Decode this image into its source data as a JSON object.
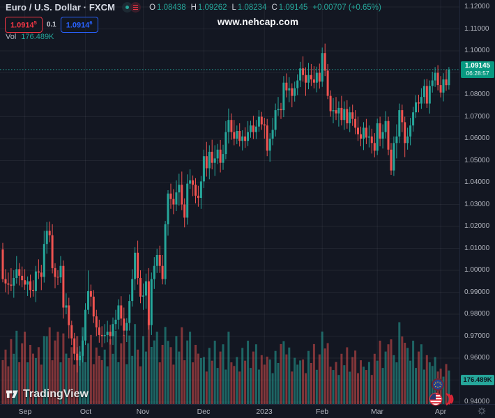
{
  "header": {
    "symbol_title": "Euro / U.S. Dollar · FXCM",
    "ohlc": {
      "o_label": "O",
      "o": "1.08438",
      "h_label": "H",
      "h": "1.09262",
      "l_label": "L",
      "l": "1.08234",
      "c_label": "C",
      "c": "1.09145",
      "change": "+0.00707 (+0.65%)"
    },
    "bid": {
      "base": "1.0914",
      "sup": "5"
    },
    "spread": "0.1",
    "ask": {
      "base": "1.0914",
      "sup": "6"
    },
    "vol_label": "Vol",
    "vol_value": "176.489K"
  },
  "watermark": "www.nehcap.com",
  "logo_text": "TradingView",
  "price_axis": {
    "labels": [
      {
        "text": "1.12000",
        "p": 1.12
      },
      {
        "text": "1.11000",
        "p": 1.11
      },
      {
        "text": "1.10000",
        "p": 1.1
      },
      {
        "text": "1.08000",
        "p": 1.08
      },
      {
        "text": "1.07000",
        "p": 1.07
      },
      {
        "text": "1.06000",
        "p": 1.06
      },
      {
        "text": "1.05000",
        "p": 1.05
      },
      {
        "text": "1.04000",
        "p": 1.04
      },
      {
        "text": "1.03000",
        "p": 1.03
      },
      {
        "text": "1.02000",
        "p": 1.02
      },
      {
        "text": "1.01000",
        "p": 1.01
      },
      {
        "text": "1.00000",
        "p": 1.0
      },
      {
        "text": "0.99000",
        "p": 0.99
      },
      {
        "text": "0.98000",
        "p": 0.98
      },
      {
        "text": "0.97000",
        "p": 0.97
      },
      {
        "text": "0.96000",
        "p": 0.96
      },
      {
        "text": "0.94000",
        "p": 0.94
      }
    ],
    "price_badge": {
      "price": "1.09145",
      "countdown": "06:28:57"
    },
    "volume_badge": "176.489K"
  },
  "colors": {
    "background": "#131722",
    "up": "#26a69a",
    "down": "#ef5350",
    "up_volume": "rgba(38,166,154,0.55)",
    "down_volume": "rgba(239,83,80,0.50)",
    "grid": "rgba(255,255,255,0.06)",
    "badge_green": "#089981",
    "bid_red": "#f23645",
    "ask_blue": "#2962ff",
    "axis_text": "#b2b5be"
  },
  "chart_data": {
    "type": "candlestick",
    "title": "Euro / U.S. Dollar · FXCM",
    "last_price": 1.09145,
    "last_price_label": "1.09145",
    "countdown": "06:28:57",
    "current_volume_label": "176.489K",
    "y_axis": {
      "min": 0.94,
      "max": 1.12,
      "tick": 0.01
    },
    "x_axis": {
      "ticks": [
        {
          "label": "Sep",
          "index": 8
        },
        {
          "label": "Oct",
          "index": 30
        },
        {
          "label": "Nov",
          "index": 51
        },
        {
          "label": "Dec",
          "index": 73
        },
        {
          "label": "2023",
          "index": 95
        },
        {
          "label": "Feb",
          "index": 116
        },
        {
          "label": "Mar",
          "index": 136
        },
        {
          "label": "Apr",
          "index": 159
        }
      ]
    },
    "volume_scale_max": 450,
    "candles": [
      [
        1.0095,
        1.0125,
        0.9945,
        0.996,
        231
      ],
      [
        0.996,
        1.0005,
        0.99,
        0.994,
        286
      ],
      [
        0.994,
        0.999,
        0.989,
        0.9935,
        198
      ],
      [
        0.9935,
        1.001,
        0.9905,
        0.993,
        341
      ],
      [
        0.993,
        1.0,
        0.9875,
        0.9965,
        264
      ],
      [
        0.9965,
        1.0065,
        0.9939,
        1.0005,
        385
      ],
      [
        1.0005,
        1.0033,
        0.9931,
        0.9975,
        220
      ],
      [
        0.9975,
        1.0017,
        0.9923,
        0.9955,
        319
      ],
      [
        0.9955,
        1.0005,
        0.9911,
        0.9935,
        380
      ],
      [
        0.9935,
        0.9972,
        0.9883,
        0.995,
        219
      ],
      [
        0.995,
        0.998,
        0.9875,
        0.991,
        311
      ],
      [
        0.991,
        0.9955,
        0.988,
        0.9905,
        265
      ],
      [
        0.9905,
        1.002,
        0.9855,
        0.9995,
        242
      ],
      [
        0.9995,
        1.005,
        0.996,
        0.999,
        299
      ],
      [
        0.999,
        1.0025,
        0.991,
        0.997,
        207
      ],
      [
        0.997,
        1.018,
        0.9944,
        1.012,
        357
      ],
      [
        1.012,
        1.022,
        1.0076,
        1.018,
        356
      ],
      [
        1.018,
        1.0222,
        1.0128,
        1.016,
        403
      ],
      [
        1.016,
        1.021,
        0.9986,
        1.001,
        230
      ],
      [
        1.001,
        1.0032,
        0.9918,
        0.997,
        334
      ],
      [
        0.997,
        1.0,
        0.9933,
        0.9968,
        380
      ],
      [
        0.9968,
        1.0065,
        0.9943,
        1.002,
        219
      ],
      [
        1.002,
        1.0045,
        0.978,
        0.983,
        371
      ],
      [
        0.983,
        0.9895,
        0.98,
        0.984,
        265
      ],
      [
        0.984,
        0.9875,
        0.969,
        0.975,
        242
      ],
      [
        0.975,
        0.977,
        0.966,
        0.969,
        299
      ],
      [
        0.969,
        0.9715,
        0.959,
        0.962,
        207
      ],
      [
        0.962,
        0.965,
        0.9535,
        0.959,
        357
      ],
      [
        0.959,
        0.9655,
        0.9565,
        0.961,
        276
      ],
      [
        0.961,
        0.97,
        0.958,
        0.968,
        403
      ],
      [
        0.968,
        0.985,
        0.966,
        0.982,
        220
      ],
      [
        0.982,
        0.9999,
        0.98,
        0.9905,
        319
      ],
      [
        0.9905,
        0.9935,
        0.9835,
        0.988,
        363
      ],
      [
        0.988,
        0.991,
        0.976,
        0.979,
        209
      ],
      [
        0.979,
        0.982,
        0.97,
        0.974,
        297
      ],
      [
        0.974,
        0.9775,
        0.967,
        0.9705,
        253
      ],
      [
        0.9705,
        0.9745,
        0.965,
        0.97,
        231
      ],
      [
        0.97,
        0.9755,
        0.9668,
        0.9705,
        286
      ],
      [
        0.9705,
        0.977,
        0.9672,
        0.972,
        198
      ],
      [
        0.972,
        0.9752,
        0.9662,
        0.97,
        341
      ],
      [
        0.97,
        0.9785,
        0.966,
        0.9755,
        264
      ],
      [
        0.9755,
        0.982,
        0.9729,
        0.9775,
        385
      ],
      [
        0.9775,
        0.9868,
        0.9731,
        0.984,
        220
      ],
      [
        0.984,
        0.9882,
        0.9748,
        0.978,
        319
      ],
      [
        0.978,
        0.983,
        0.9701,
        0.9725,
        363
      ],
      [
        0.9725,
        0.9782,
        0.9673,
        0.976,
        209
      ],
      [
        0.976,
        0.989,
        0.9725,
        0.986,
        360
      ],
      [
        0.986,
        1.0005,
        0.9835,
        0.996,
        253
      ],
      [
        0.996,
        1.0105,
        0.991,
        1.008,
        420
      ],
      [
        1.008,
        1.0135,
        0.9935,
        0.9965,
        286
      ],
      [
        0.9965,
        1.0,
        0.985,
        0.988,
        198
      ],
      [
        0.988,
        0.994,
        0.982,
        0.9885,
        357
      ],
      [
        0.9885,
        0.9985,
        0.9825,
        0.995,
        276
      ],
      [
        0.995,
        1.001,
        0.973,
        0.975,
        445
      ],
      [
        0.975,
        0.999,
        0.9705,
        0.996,
        300
      ],
      [
        0.996,
        1.006,
        0.9915,
        1.002,
        334
      ],
      [
        1.002,
        1.0098,
        0.9988,
        1.007,
        380
      ],
      [
        1.007,
        1.0112,
        0.9988,
        1.002,
        219
      ],
      [
        1.002,
        1.007,
        0.9936,
        0.996,
        311
      ],
      [
        0.996,
        1.0225,
        0.9935,
        1.021,
        405
      ],
      [
        1.021,
        1.0365,
        1.0158,
        1.035,
        332
      ],
      [
        1.035,
        1.0395,
        1.028,
        1.0325,
        299
      ],
      [
        1.0325,
        1.037,
        1.0256,
        1.03,
        207
      ],
      [
        1.03,
        1.041,
        1.027,
        1.0355,
        357
      ],
      [
        1.0355,
        1.044,
        1.0295,
        1.039,
        276
      ],
      [
        1.039,
        1.045,
        1.0274,
        1.03,
        403
      ],
      [
        1.03,
        1.0328,
        1.0196,
        1.024,
        230
      ],
      [
        1.024,
        1.0437,
        1.0208,
        1.0395,
        334
      ],
      [
        1.0395,
        1.046,
        1.0371,
        1.041,
        380
      ],
      [
        1.041,
        1.0432,
        1.0338,
        1.039,
        219
      ],
      [
        1.039,
        1.042,
        1.0305,
        1.034,
        311
      ],
      [
        1.034,
        1.0385,
        1.029,
        1.033,
        265
      ],
      [
        1.033,
        1.043,
        1.028,
        1.0405,
        242
      ],
      [
        1.0405,
        1.055,
        1.0375,
        1.052,
        247
      ],
      [
        1.052,
        1.0585,
        1.0427,
        1.0465,
        171
      ],
      [
        1.0465,
        1.057,
        1.0415,
        1.054,
        295
      ],
      [
        1.054,
        1.0595,
        1.046,
        1.049,
        228
      ],
      [
        1.049,
        1.057,
        1.043,
        1.051,
        333
      ],
      [
        1.051,
        1.0576,
        1.0484,
        1.055,
        190
      ],
      [
        1.055,
        1.0594,
        1.0446,
        1.049,
        276
      ],
      [
        1.049,
        1.0572,
        1.0458,
        1.053,
        314
      ],
      [
        1.053,
        1.068,
        1.0506,
        1.063,
        181
      ],
      [
        1.063,
        1.0737,
        1.0578,
        1.0685,
        380
      ],
      [
        1.0685,
        1.0715,
        1.0595,
        1.063,
        219
      ],
      [
        1.063,
        1.0685,
        1.057,
        1.06,
        200
      ],
      [
        1.06,
        1.066,
        1.0575,
        1.0635,
        247
      ],
      [
        1.0635,
        1.067,
        1.0564,
        1.059,
        171
      ],
      [
        1.059,
        1.0638,
        1.0546,
        1.061,
        295
      ],
      [
        1.061,
        1.0652,
        1.0558,
        1.059,
        228
      ],
      [
        1.059,
        1.068,
        1.0566,
        1.063,
        333
      ],
      [
        1.063,
        1.0682,
        1.0604,
        1.066,
        190
      ],
      [
        1.066,
        1.0704,
        1.0598,
        1.063,
        276
      ],
      [
        1.063,
        1.0685,
        1.0598,
        1.0655,
        314
      ],
      [
        1.0655,
        1.073,
        1.0631,
        1.07,
        181
      ],
      [
        1.07,
        1.0722,
        1.064,
        1.0665,
        257
      ],
      [
        1.0665,
        1.0695,
        1.06,
        1.066,
        207
      ],
      [
        1.066,
        1.069,
        1.052,
        1.0545,
        249
      ],
      [
        1.0545,
        1.0625,
        1.0495,
        1.06,
        234
      ],
      [
        1.06,
        1.0695,
        1.057,
        1.064,
        162
      ],
      [
        1.064,
        1.076,
        1.061,
        1.073,
        279
      ],
      [
        1.073,
        1.079,
        1.0704,
        1.0735,
        216
      ],
      [
        1.0735,
        1.0763,
        1.069,
        1.073,
        315
      ],
      [
        1.073,
        1.0885,
        1.0698,
        1.0855,
        330
      ],
      [
        1.0855,
        1.0897,
        1.0788,
        1.082,
        261
      ],
      [
        1.082,
        1.088,
        1.0766,
        1.083,
        297
      ],
      [
        1.083,
        1.0852,
        1.0743,
        1.0795,
        171
      ],
      [
        1.0795,
        1.086,
        1.0769,
        1.083,
        243
      ],
      [
        1.083,
        1.0893,
        1.0798,
        1.0865,
        207
      ],
      [
        1.0865,
        1.095,
        1.0835,
        1.092,
        229
      ],
      [
        1.092,
        1.0975,
        1.086,
        1.089,
        234
      ],
      [
        1.089,
        1.0925,
        1.0795,
        1.0855,
        162
      ],
      [
        1.0855,
        1.0945,
        1.0825,
        1.089,
        279
      ],
      [
        1.089,
        1.094,
        1.084,
        1.087,
        216
      ],
      [
        1.087,
        1.093,
        1.0829,
        1.0855,
        315
      ],
      [
        1.0855,
        1.0928,
        1.0811,
        1.09,
        180
      ],
      [
        1.09,
        1.0942,
        1.0828,
        1.086,
        261
      ],
      [
        1.086,
        1.1015,
        1.0836,
        1.099,
        381
      ],
      [
        1.099,
        1.1033,
        1.0885,
        1.091,
        292
      ],
      [
        1.091,
        1.094,
        1.078,
        1.0795,
        320
      ],
      [
        1.0795,
        1.082,
        1.07,
        1.0725,
        196
      ],
      [
        1.0725,
        1.0785,
        1.067,
        1.073,
        179
      ],
      [
        1.073,
        1.079,
        1.0685,
        1.0715,
        221
      ],
      [
        1.0715,
        1.077,
        1.0655,
        1.074,
        153
      ],
      [
        1.074,
        1.0795,
        1.066,
        1.0685,
        264
      ],
      [
        1.0685,
        1.077,
        1.064,
        1.0735,
        204
      ],
      [
        1.0735,
        1.0775,
        1.0645,
        1.067,
        298
      ],
      [
        1.067,
        1.0745,
        1.063,
        1.072,
        170
      ],
      [
        1.072,
        1.0755,
        1.0658,
        1.069,
        247
      ],
      [
        1.069,
        1.073,
        1.062,
        1.065,
        281
      ],
      [
        1.065,
        1.07,
        1.059,
        1.062,
        162
      ],
      [
        1.062,
        1.0655,
        1.0565,
        1.06,
        230
      ],
      [
        1.06,
        1.0675,
        1.0548,
        1.065,
        196
      ],
      [
        1.065,
        1.069,
        1.0575,
        1.0605,
        179
      ],
      [
        1.0605,
        1.066,
        1.056,
        1.061,
        221
      ],
      [
        1.061,
        1.0645,
        1.0532,
        1.058,
        153
      ],
      [
        1.058,
        1.0625,
        1.0515,
        1.0545,
        264
      ],
      [
        1.0545,
        1.0691,
        1.0525,
        1.067,
        228
      ],
      [
        1.067,
        1.07,
        1.0565,
        1.06,
        333
      ],
      [
        1.06,
        1.0665,
        1.0555,
        1.063,
        190
      ],
      [
        1.063,
        1.0725,
        1.0601,
        1.068,
        276
      ],
      [
        1.068,
        1.07,
        1.0524,
        1.055,
        314
      ],
      [
        1.055,
        1.058,
        1.0435,
        1.0455,
        340
      ],
      [
        1.0455,
        1.061,
        1.043,
        1.058,
        257
      ],
      [
        1.058,
        1.0665,
        1.051,
        1.061,
        219
      ],
      [
        1.061,
        1.076,
        1.058,
        1.073,
        430
      ],
      [
        1.073,
        1.0755,
        1.063,
        1.0675,
        355
      ],
      [
        1.0675,
        1.07,
        1.0516,
        1.058,
        322
      ],
      [
        1.058,
        1.065,
        1.055,
        1.061,
        295
      ],
      [
        1.061,
        1.0695,
        1.057,
        1.066,
        228
      ],
      [
        1.066,
        1.0745,
        1.0632,
        1.072,
        333
      ],
      [
        1.072,
        1.0798,
        1.0694,
        1.0765,
        190
      ],
      [
        1.0765,
        1.08,
        1.072,
        1.076,
        276
      ],
      [
        1.076,
        1.083,
        1.0736,
        1.079,
        314
      ],
      [
        1.079,
        1.087,
        1.076,
        1.084,
        181
      ],
      [
        1.084,
        1.0872,
        1.074,
        1.076,
        257
      ],
      [
        1.076,
        1.0865,
        1.0714,
        1.084,
        219
      ],
      [
        1.084,
        1.0905,
        1.081,
        1.0865,
        200
      ],
      [
        1.0865,
        1.0926,
        1.0836,
        1.09,
        247
      ],
      [
        1.09,
        1.0935,
        1.082,
        1.0844,
        171
      ],
      [
        1.0844,
        1.0885,
        1.0788,
        1.081,
        186
      ],
      [
        1.081,
        1.0898,
        1.077,
        1.087,
        144
      ],
      [
        1.087,
        1.0915,
        1.0818,
        1.0844,
        210
      ],
      [
        1.08438,
        1.09262,
        1.08234,
        1.09145,
        176.489
      ]
    ]
  }
}
